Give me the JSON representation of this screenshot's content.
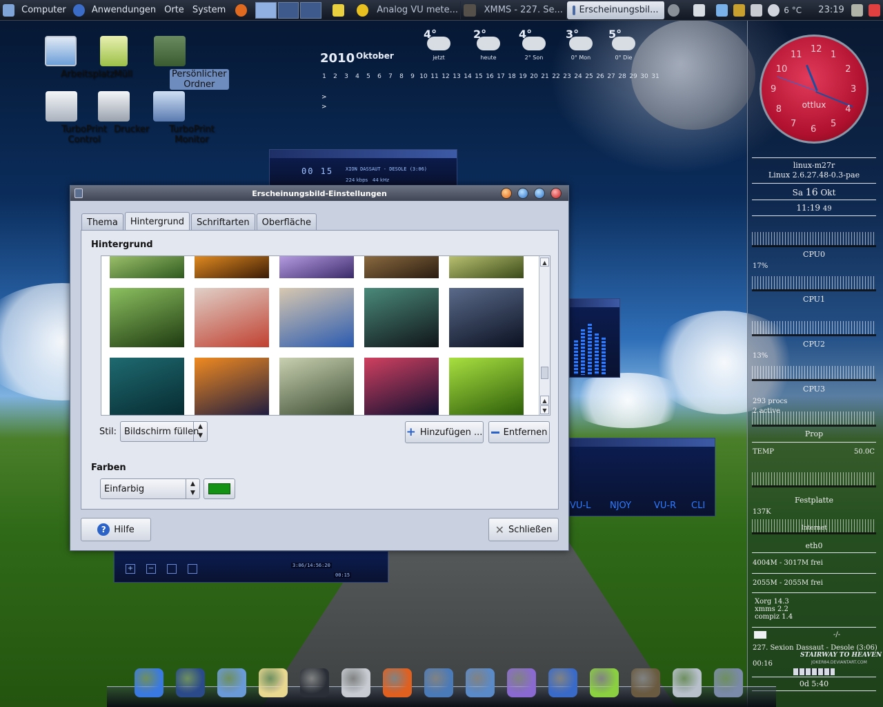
{
  "top_panel": {
    "menus": [
      "Computer",
      "Anwendungen",
      "Orte",
      "System"
    ],
    "tasks": [
      {
        "label": "Analog VU mete...",
        "active": false
      },
      {
        "label": "XMMS - 227. Se...",
        "active": false
      },
      {
        "label": "Erscheinungsbil...",
        "active": true
      }
    ],
    "temperature": "6 °C",
    "time": "23:19"
  },
  "desktop_icons": [
    {
      "label": "Arbeitsplatz",
      "selected": false
    },
    {
      "label": "Müll",
      "selected": false
    },
    {
      "label": "Persönlicher Ordner",
      "selected": true
    },
    {
      "label": "TurboPrint Control",
      "selected": false
    },
    {
      "label": "Drucker",
      "selected": false
    },
    {
      "label": "TurboPrint Monitor",
      "selected": false
    }
  ],
  "calendar": {
    "year": "2010",
    "month": "Oktober",
    "days": [
      "1",
      "2",
      "3",
      "4",
      "5",
      "6",
      "7",
      "8",
      "9",
      "10",
      "11",
      "12",
      "13",
      "14",
      "15",
      "16",
      "17",
      "18",
      "19",
      "20",
      "21",
      "22",
      "23",
      "24",
      "25",
      "26",
      "27",
      "28",
      "29",
      "30",
      "31"
    ],
    "arrows": [
      ">",
      ">"
    ],
    "weather": [
      {
        "temp": "4°",
        "name": "jetzt"
      },
      {
        "temp": "2°",
        "name": "heute"
      },
      {
        "temp": "4°",
        "low": "2°",
        "name": "Son"
      },
      {
        "temp": "3°",
        "low": "0°",
        "name": "Mon"
      },
      {
        "temp": "5°",
        "low": "0°",
        "name": "Die"
      }
    ]
  },
  "xmms": {
    "time": "00 15",
    "track": "XION DASSAUT - DESOLE (3:06)",
    "kbps": "224",
    "kbps_unit": "kbps",
    "khz": "44",
    "khz_unit": "kHz",
    "playlist_time": "3:06/14:56:20",
    "playlist_pos": "00:15",
    "vu_labels": [
      "VU-L",
      "NJOY",
      "VU-R",
      "CLI"
    ]
  },
  "clock": {
    "brand": "ottlux",
    "numbers": [
      "12",
      "1",
      "2",
      "3",
      "4",
      "5",
      "6",
      "7",
      "8",
      "9",
      "10",
      "11"
    ]
  },
  "sidebar": {
    "hostname": "linux-m27r",
    "kernel": "Linux 2.6.27.48-0.3-pae",
    "date_day": "Sa",
    "date_num": "16",
    "date_month": "Okt",
    "time": "11:19",
    "seconds": "49",
    "cpus": [
      {
        "label": "CPU0",
        "value": "17%"
      },
      {
        "label": "CPU1",
        "value": ""
      },
      {
        "label": "CPU2",
        "value": "13%"
      },
      {
        "label": "CPU3",
        "value": ""
      }
    ],
    "procs": "293 procs",
    "procs_extra": "2 active",
    "prop_label": "Prop",
    "temp_label": "TEMP",
    "temp_value": "50.0C",
    "disk_label": "Festplatte",
    "disk_value": "137K",
    "internet_label": "Internet",
    "net_label": "eth0",
    "mem1": "4004M - 3017M frei",
    "mem2": "2055M - 2055M frei",
    "apps": [
      "Xorg 14.3",
      "xmms   2.2",
      "compiz  1.4"
    ],
    "mail_right": "-/-",
    "now_playing": "227. Sexion Dassaut - Desole (3:06)",
    "player_time": "00:16",
    "player_title": "STAIRWAY TO HEAVEN",
    "player_sub": "JOKER84.DEVIANTART.COM",
    "uptime": "0d  5:40"
  },
  "dialog": {
    "title": "Erscheinungsbild-Einstellungen",
    "tabs": [
      {
        "label": "Thema",
        "active": false
      },
      {
        "label": "Hintergrund",
        "active": true
      },
      {
        "label": "Schriftarten",
        "active": false
      },
      {
        "label": "Oberfläche",
        "active": false
      }
    ],
    "section_background": "Hintergrund",
    "style_label": "Stil:",
    "style_value": "Bildschirm füllen",
    "add_label": "Hinzufügen ...",
    "remove_label": "Entfernen",
    "section_colors": "Farben",
    "color_mode": "Einfarbig",
    "color_value": "#149214",
    "help_label": "Hilfe",
    "close_label": "Schließen"
  },
  "wallpaper_thumbs": [
    {
      "name": "foliage",
      "c1": "#2e5a1e",
      "c2": "#9bbf6a"
    },
    {
      "name": "fire-forest",
      "c1": "#3a1b05",
      "c2": "#e08a20"
    },
    {
      "name": "purple-sky",
      "c1": "#3a2a6a",
      "c2": "#b59be0"
    },
    {
      "name": "dusk",
      "c1": "#2a1c10",
      "c2": "#8a6a40"
    },
    {
      "name": "grass",
      "c1": "#3a4a18",
      "c2": "#b8c070"
    },
    {
      "name": "bonsai",
      "c1": "#1e3a10",
      "c2": "#8cc060"
    },
    {
      "name": "bridge",
      "c1": "#c04030",
      "c2": "#e0d0c8"
    },
    {
      "name": "city",
      "c1": "#2a5ab0",
      "c2": "#d8c8b0"
    },
    {
      "name": "night-street",
      "c1": "#101418",
      "c2": "#4a8a7a"
    },
    {
      "name": "watch",
      "c1": "#0a1020",
      "c2": "#5a6a8a"
    },
    {
      "name": "teal-grid",
      "c1": "#062a30",
      "c2": "#1e6a70"
    },
    {
      "name": "flame-swirl",
      "c1": "#1a1a40",
      "c2": "#f08a20"
    },
    {
      "name": "garden",
      "c1": "#3a4a30",
      "c2": "#c8d0b0"
    },
    {
      "name": "tower",
      "c1": "#0a0e30",
      "c2": "#d04060"
    },
    {
      "name": "frog",
      "c1": "#2a5a08",
      "c2": "#a8e040"
    }
  ],
  "dock_icons": [
    "globe-icon",
    "home-icon",
    "mail-icon",
    "notes-icon",
    "terminal-icon",
    "settings-icon",
    "firefox-icon",
    "music-icon",
    "network-icon",
    "office-icon",
    "writer-icon",
    "lime-icon",
    "gimp-icon",
    "cd-icon",
    "trash-icon"
  ]
}
